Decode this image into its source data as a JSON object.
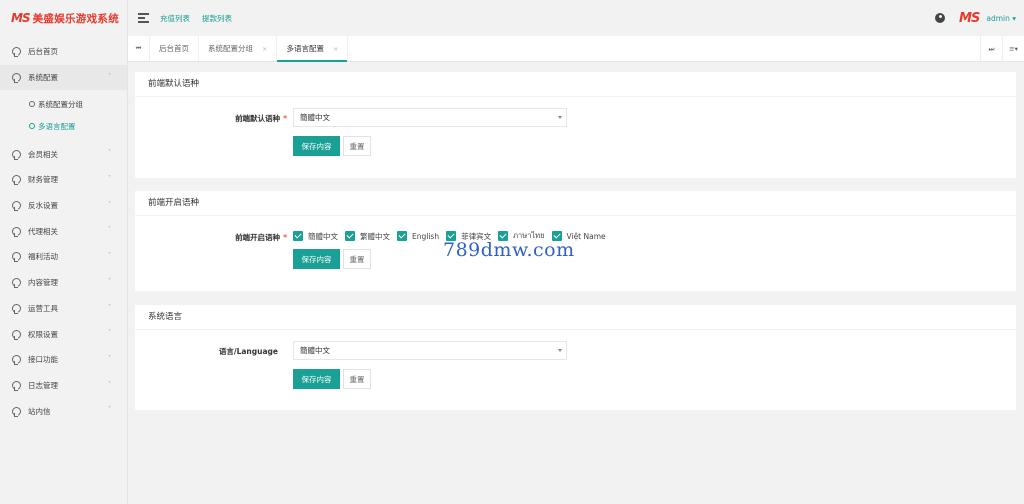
{
  "brand": {
    "logo_mark": "MS",
    "name": "美盛娱乐游戏系统"
  },
  "header": {
    "links": [
      "充值列表",
      "提款列表"
    ],
    "avatar_text": "MS",
    "user": "admin ▾"
  },
  "sidebar": {
    "items": [
      {
        "label": "后台首页",
        "arrow": ""
      },
      {
        "label": "系统配置",
        "arrow": "˄"
      },
      {
        "label": "会员相关",
        "arrow": "˅"
      },
      {
        "label": "财务管理",
        "arrow": "˅"
      },
      {
        "label": "反水设置",
        "arrow": "˅"
      },
      {
        "label": "代理相关",
        "arrow": "˅"
      },
      {
        "label": "福利活动",
        "arrow": "˅"
      },
      {
        "label": "内容管理",
        "arrow": "˅"
      },
      {
        "label": "运营工具",
        "arrow": "˅"
      },
      {
        "label": "权限设置",
        "arrow": "˅"
      },
      {
        "label": "接口功能",
        "arrow": "˅"
      },
      {
        "label": "日志管理",
        "arrow": "˅"
      },
      {
        "label": "站内信",
        "arrow": "˅"
      }
    ],
    "subitems": [
      {
        "label": "系统配置分组"
      },
      {
        "label": "多语言配置"
      }
    ]
  },
  "tabs": {
    "first_nav": "⏮",
    "items": [
      {
        "label": "后台首页",
        "close": ""
      },
      {
        "label": "系统配置分组",
        "close": "×"
      },
      {
        "label": "多语言配置",
        "close": "×"
      }
    ],
    "right_nav": "⏭",
    "menu_icon": "≡▾"
  },
  "cards": {
    "default_lang": {
      "title": "前端默认语种",
      "label": "前端默认语种",
      "required": "*",
      "select_value": "簡體中文",
      "save": "保存内容",
      "reset": "重置"
    },
    "enabled_langs": {
      "title": "前端开启语种",
      "label": "前端开启语种",
      "required": "*",
      "options": [
        "簡體中文",
        "繁體中文",
        "English",
        "菲律宾文",
        "ภาษาไทย",
        "Việt Name"
      ],
      "save": "保存内容",
      "reset": "重置"
    },
    "system_lang": {
      "title": "系统语言",
      "label": "语言/Language",
      "select_value": "簡體中文",
      "save": "保存内容",
      "reset": "重置"
    }
  },
  "watermark": "789dmw.com",
  "colors": {
    "accent": "#1aa094",
    "brand": "#e8392d",
    "required": "#ff5722"
  }
}
